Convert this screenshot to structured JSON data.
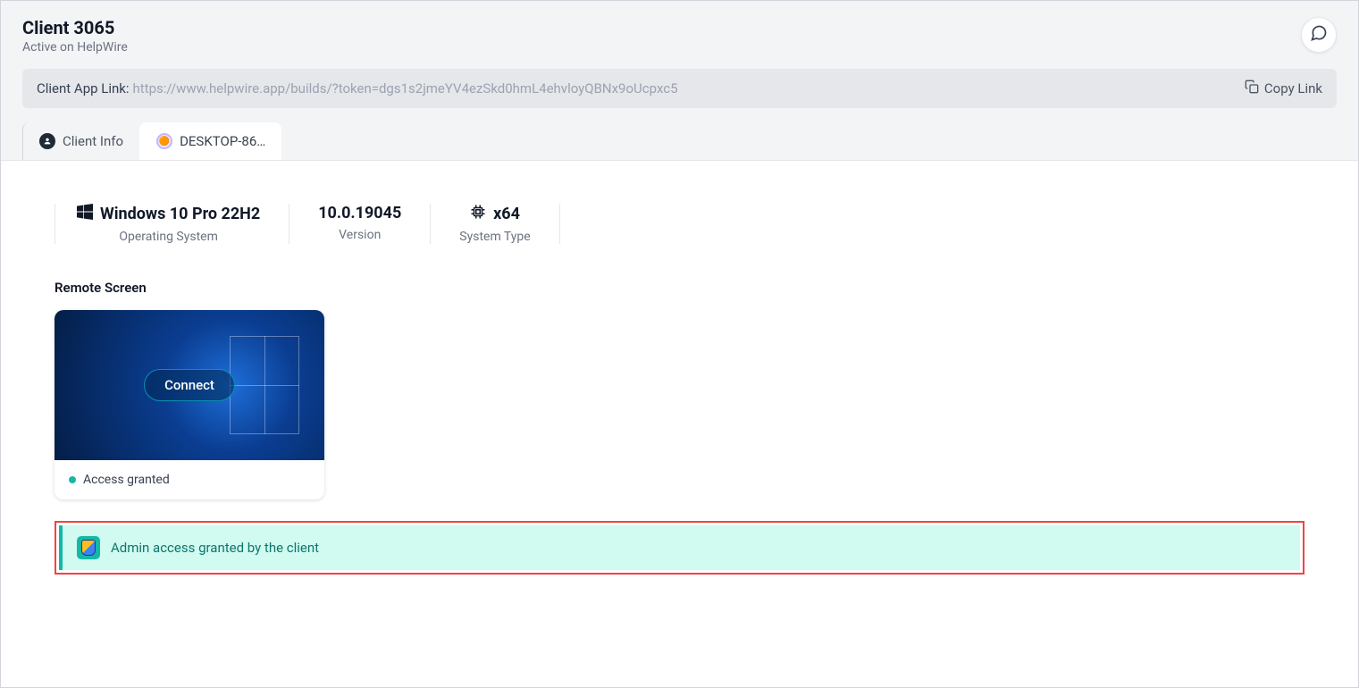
{
  "header": {
    "title": "Client 3065",
    "subtitle": "Active on HelpWire"
  },
  "linkBar": {
    "label": "Client App Link:",
    "url": "https://www.helpwire.app/builds/?token=dgs1s2jmeYV4ezSkd0hmL4ehvloyQBNx9oUcpxc5",
    "copyLabel": "Copy Link"
  },
  "tabs": {
    "clientInfo": "Client Info",
    "desktop": "DESKTOP-86…"
  },
  "systemInfo": {
    "os": {
      "value": "Windows 10 Pro 22H2",
      "label": "Operating System"
    },
    "version": {
      "value": "10.0.19045",
      "label": "Version"
    },
    "arch": {
      "value": "x64",
      "label": "System Type"
    }
  },
  "remoteScreen": {
    "sectionTitle": "Remote Screen",
    "connectLabel": "Connect",
    "statusText": "Access granted"
  },
  "adminBanner": {
    "text": "Admin access granted by the client"
  }
}
